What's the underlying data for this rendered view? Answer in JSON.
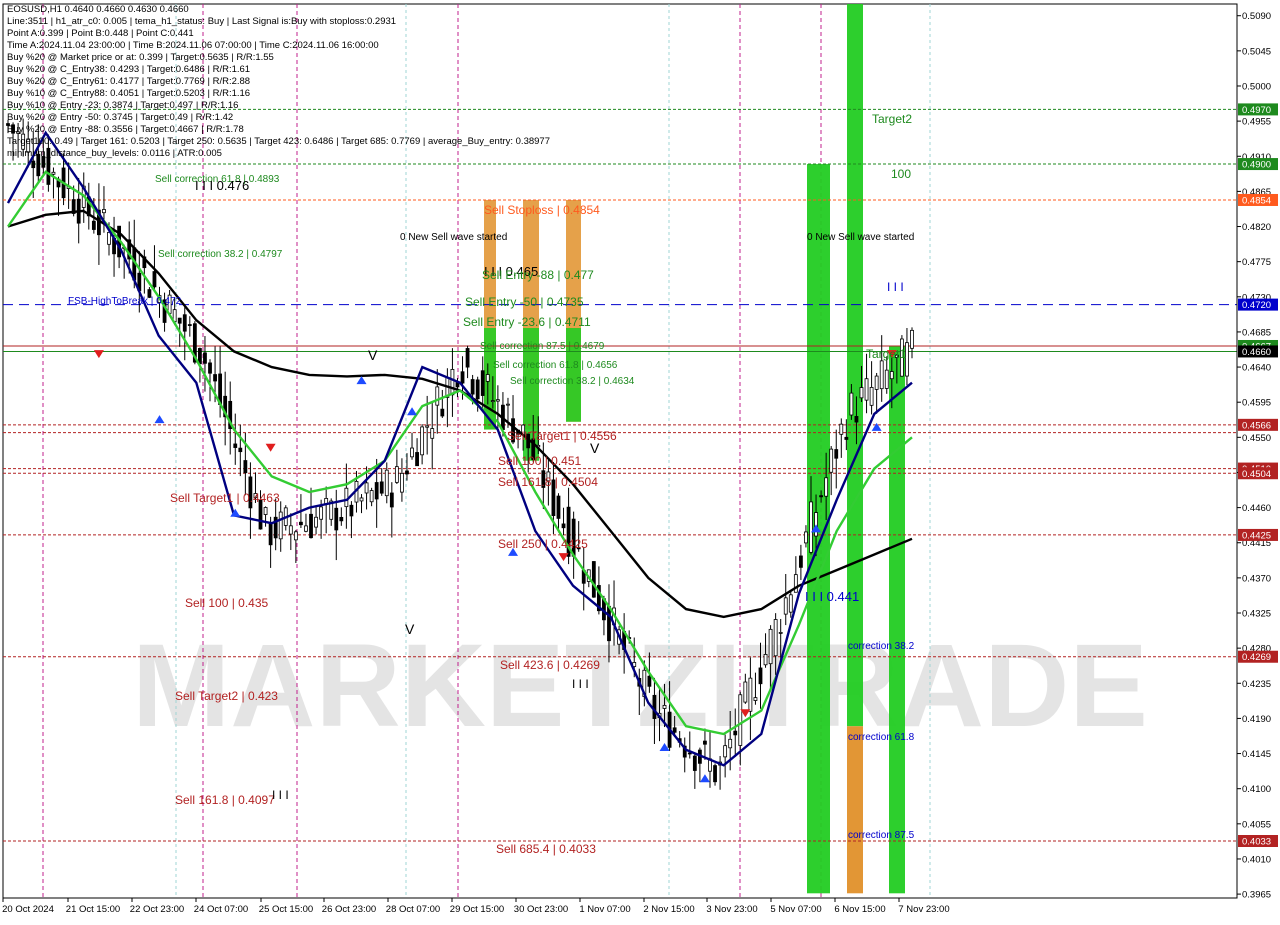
{
  "info_lines": [
    "EOSUSD,H1  0.4640 0.4660 0.4630 0.4660",
    "Line:3511  |  h1_atr_c0: 0.005  |  tema_h1_status: Buy  |  Last Signal is:Buy with stoploss:0.2931",
    "Point A:0.399  |  Point B:0.448  |  Point C:0.441",
    "Time A:2024.11.04 23:00:00  |  Time B:2024.11.06 07:00:00  |  Time C:2024.11.06 16:00:00",
    "Buy %20 @ Market price or at: 0.399  |  Target:0.5635  |  R/R:1.55",
    "Buy %20 @ C_Entry38: 0.4293  |  Target:0.6486  |  R/R:1.61",
    "Buy %20 @ C_Entry61: 0.4177  |  Target:0.7769  |  R/R:2.88",
    "Buy %10 @ C_Entry88: 0.4051  |  Target:0.5203  |  R/R:1.16",
    "Buy %10 @ Entry -23: 0.3874  |  Target:0.497  |  R/R:1.16",
    "Buy %20 @ Entry -50: 0.3745  |  Target:0.49  |  R/R:1.42",
    "Buy %20 @ Entry -88: 0.3556  |  Target:0.4667  |  R/R:1.78",
    "Target100: 0.49  |  Target 161: 0.5203  |  Target 250: 0.5635  |  Target 423: 0.6486  |  Target 685: 0.7769  |  average_Buy_entry: 0.38977",
    "minimum_distance_buy_levels: 0.0116  |  ATR:0.005"
  ],
  "watermark": "MARKETZITRADE",
  "colors": {
    "sell_level": "#b22222",
    "buy_level": "#1e8a1e",
    "blue_line": "#0000cc",
    "accent_orange": "#ff5a1e",
    "tema_line": "#000080",
    "ema_green": "#33cc33",
    "ma_black": "#000000",
    "green_zone": "#22cc22",
    "orange_zone": "#e0902a"
  },
  "chart_data": {
    "type": "candlestick",
    "symbol": "EOSUSD",
    "timeframe": "H1",
    "ylim": [
      0.396,
      0.5105
    ],
    "y_ticks": [
      "0.5090",
      "0.5045",
      "0.5000",
      "0.4955",
      "0.4910",
      "0.4865",
      "0.4820",
      "0.4775",
      "0.4730",
      "0.4685",
      "0.4640",
      "0.4595",
      "0.4550",
      "0.4505",
      "0.4460",
      "0.4415",
      "0.4370",
      "0.4325",
      "0.4280",
      "0.4235",
      "0.4190",
      "0.4145",
      "0.4100",
      "0.4055",
      "0.4010",
      "0.3965"
    ],
    "x_labels": [
      "20 Oct 2024",
      "21 Oct 15:00",
      "22 Oct 23:00",
      "24 Oct 07:00",
      "25 Oct 15:00",
      "26 Oct 23:00",
      "28 Oct 07:00",
      "29 Oct 15:00",
      "30 Oct 23:00",
      "1 Nov 07:00",
      "2 Nov 15:00",
      "3 Nov 23:00",
      "5 Nov 07:00",
      "6 Nov 15:00",
      "7 Nov 23:00"
    ],
    "price_tags": [
      {
        "label": "0.4970",
        "value": 0.497,
        "color": "#1e8a1e"
      },
      {
        "label": "0.4900",
        "value": 0.49,
        "color": "#1e8a1e"
      },
      {
        "label": "0.4854",
        "value": 0.4854,
        "color": "#ff5a1e"
      },
      {
        "label": "0.4720",
        "value": 0.472,
        "color": "#0000cc"
      },
      {
        "label": "0.4667",
        "value": 0.4667,
        "color": "#1e8a1e"
      },
      {
        "label": "0.4660",
        "value": 0.466,
        "color": "#000000"
      },
      {
        "label": "0.4566",
        "value": 0.4566,
        "color": "#b22222"
      },
      {
        "label": "0.4510",
        "value": 0.451,
        "color": "#b22222"
      },
      {
        "label": "0.4504",
        "value": 0.4504,
        "color": "#b22222"
      },
      {
        "label": "0.4425",
        "value": 0.4425,
        "color": "#b22222"
      },
      {
        "label": "0.4269",
        "value": 0.4269,
        "color": "#b22222"
      },
      {
        "label": "0.4033",
        "value": 0.4033,
        "color": "#b22222"
      }
    ],
    "h_levels": [
      {
        "value": 0.497,
        "color": "#1e8a1e",
        "dash": "3,2"
      },
      {
        "value": 0.49,
        "color": "#1e8a1e",
        "dash": "3,2"
      },
      {
        "value": 0.4854,
        "color": "#ff5a1e",
        "dash": "3,2"
      },
      {
        "value": 0.472,
        "color": "#0000cc",
        "dash": "10,6"
      },
      {
        "value": 0.4667,
        "color": "#b22222",
        "dash": ""
      },
      {
        "value": 0.466,
        "color": "#1e8a1e",
        "dash": ""
      },
      {
        "value": 0.4566,
        "color": "#b22222",
        "dash": "3,2"
      },
      {
        "value": 0.4556,
        "color": "#b22222",
        "dash": "3,2"
      },
      {
        "value": 0.451,
        "color": "#b22222",
        "dash": "3,2"
      },
      {
        "value": 0.4504,
        "color": "#b22222",
        "dash": "3,2"
      },
      {
        "value": 0.4425,
        "color": "#b22222",
        "dash": "3,2"
      },
      {
        "value": 0.4269,
        "color": "#b22222",
        "dash": "3,2"
      },
      {
        "value": 0.4033,
        "color": "#b22222",
        "dash": "3,2"
      }
    ],
    "annotations": [
      {
        "text": "Sell correction 61.8 | 0.4893",
        "color": "#1e8a1e"
      },
      {
        "text": "I I I  0.476",
        "color": "#000000"
      },
      {
        "text": "Sell correction 38.2 | 0.4797",
        "color": "#1e8a1e"
      },
      {
        "text": "FSB-HighToBreak | 0.472",
        "color": "#0000cc"
      },
      {
        "text": "Sell Target1 | 0.4463",
        "color": "#b22222"
      },
      {
        "text": "Sell 100 | 0.435",
        "color": "#b22222"
      },
      {
        "text": "Sell Target2 | 0.423",
        "color": "#b22222"
      },
      {
        "text": "Sell 161.8 | 0.4097",
        "color": "#b22222"
      },
      {
        "text": "I I I",
        "color": "#000000"
      },
      {
        "text": "Sell Stoploss | 0.4854",
        "color": "#ff5a1e"
      },
      {
        "text": "0 New Sell wave started",
        "color": "#000000"
      },
      {
        "text": "I I I 0.465",
        "color": "#000000"
      },
      {
        "text": "Sell Entry -88 | 0.477",
        "color": "#1e8a1e"
      },
      {
        "text": "Sell Entry -50 | 0.4735",
        "color": "#1e8a1e"
      },
      {
        "text": "Sell Entry -23.6 | 0.4711",
        "color": "#1e8a1e"
      },
      {
        "text": "Sell correction 87.5 | 0.4679",
        "color": "#1e8a1e"
      },
      {
        "text": "Sell correction 61.8 | 0.4656",
        "color": "#1e8a1e"
      },
      {
        "text": "Sell correction 38.2 | 0.4634",
        "color": "#1e8a1e"
      },
      {
        "text": "Sell Target1 | 0.4556",
        "color": "#b22222"
      },
      {
        "text": "Sell 100 | 0.451",
        "color": "#b22222"
      },
      {
        "text": "Sell 161.8 | 0.4504",
        "color": "#b22222"
      },
      {
        "text": "Sell 250 | 0.4425",
        "color": "#b22222"
      },
      {
        "text": "Sell 423.6 | 0.4269",
        "color": "#b22222"
      },
      {
        "text": "I I I",
        "color": "#000000"
      },
      {
        "text": "Sell 685.4 | 0.4033",
        "color": "#b22222"
      },
      {
        "text": "0 New Sell wave started",
        "color": "#000000"
      },
      {
        "text": "Target2",
        "color": "#1e8a1e"
      },
      {
        "text": "100",
        "color": "#1e8a1e"
      },
      {
        "text": "I I I",
        "color": "#0000cc"
      },
      {
        "text": "Target1",
        "color": "#1e8a1e"
      },
      {
        "text": "I I I 0.441",
        "color": "#0000cc"
      },
      {
        "text": "correction 38.2",
        "color": "#0000cc"
      },
      {
        "text": "correction 61.8",
        "color": "#0000cc"
      },
      {
        "text": "correction 87.5",
        "color": "#0000cc"
      },
      {
        "text": "V",
        "color": "#000000"
      },
      {
        "text": "V",
        "color": "#000000"
      },
      {
        "text": "V",
        "color": "#000000"
      }
    ],
    "ohlc_approx": [
      {
        "t": "20 Oct 2024",
        "o": 0.48,
        "h": 0.504,
        "l": 0.478,
        "c": 0.495
      },
      {
        "t": "21 Oct 15:00",
        "o": 0.495,
        "h": 0.5,
        "l": 0.483,
        "c": 0.486
      },
      {
        "t": "22 Oct 23:00",
        "o": 0.486,
        "h": 0.488,
        "l": 0.474,
        "c": 0.477
      },
      {
        "t": "24 Oct 07:00",
        "o": 0.477,
        "h": 0.479,
        "l": 0.461,
        "c": 0.466
      },
      {
        "t": "25 Oct 15:00",
        "o": 0.466,
        "h": 0.476,
        "l": 0.433,
        "c": 0.443
      },
      {
        "t": "26 Oct 23:00",
        "o": 0.443,
        "h": 0.449,
        "l": 0.436,
        "c": 0.445
      },
      {
        "t": "28 Oct 07:00",
        "o": 0.445,
        "h": 0.451,
        "l": 0.44,
        "c": 0.449
      },
      {
        "t": "29 Oct 15:00",
        "o": 0.449,
        "h": 0.47,
        "l": 0.448,
        "c": 0.465
      },
      {
        "t": "30 Oct 23:00",
        "o": 0.465,
        "h": 0.469,
        "l": 0.45,
        "c": 0.455
      },
      {
        "t": "1 Nov 07:00",
        "o": 0.455,
        "h": 0.457,
        "l": 0.433,
        "c": 0.437
      },
      {
        "t": "2 Nov 15:00",
        "o": 0.437,
        "h": 0.438,
        "l": 0.417,
        "c": 0.42
      },
      {
        "t": "3 Nov 23:00",
        "o": 0.42,
        "h": 0.423,
        "l": 0.398,
        "c": 0.412
      },
      {
        "t": "5 Nov 07:00",
        "o": 0.412,
        "h": 0.44,
        "l": 0.41,
        "c": 0.433
      },
      {
        "t": "6 Nov 15:00",
        "o": 0.433,
        "h": 0.469,
        "l": 0.432,
        "c": 0.458
      },
      {
        "t": "7 Nov 23:00",
        "o": 0.458,
        "h": 0.471,
        "l": 0.456,
        "c": 0.466
      }
    ],
    "tema_line": [
      0.485,
      0.494,
      0.487,
      0.479,
      0.468,
      0.462,
      0.445,
      0.444,
      0.446,
      0.447,
      0.452,
      0.464,
      0.462,
      0.456,
      0.443,
      0.436,
      0.432,
      0.421,
      0.415,
      0.413,
      0.417,
      0.435,
      0.447,
      0.458,
      0.462
    ],
    "ema_line": [
      0.482,
      0.489,
      0.486,
      0.48,
      0.473,
      0.465,
      0.456,
      0.45,
      0.448,
      0.449,
      0.452,
      0.459,
      0.461,
      0.457,
      0.448,
      0.44,
      0.433,
      0.425,
      0.418,
      0.417,
      0.42,
      0.431,
      0.443,
      0.451,
      0.455
    ],
    "ma_line": [
      0.482,
      0.4835,
      0.484,
      0.481,
      0.476,
      0.47,
      0.466,
      0.464,
      0.463,
      0.4628,
      0.463,
      0.4625,
      0.461,
      0.458,
      0.454,
      0.449,
      0.443,
      0.437,
      0.433,
      0.432,
      0.433,
      0.436,
      0.438,
      0.44,
      0.442
    ]
  }
}
